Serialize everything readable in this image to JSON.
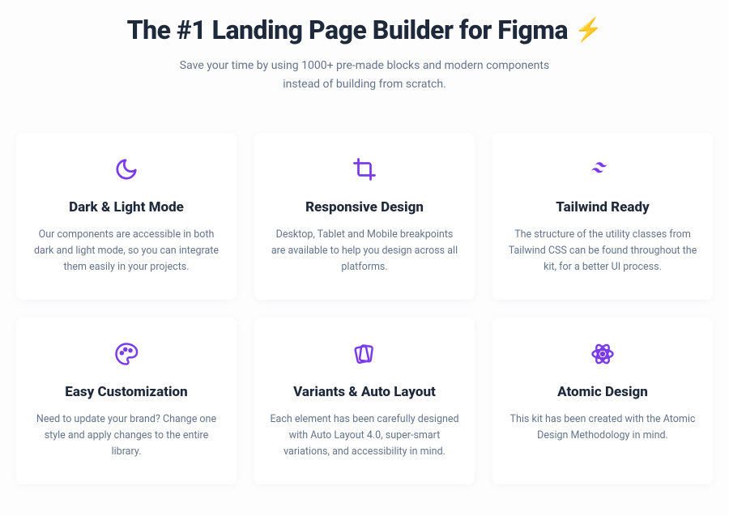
{
  "hero": {
    "title": "The #1 Landing Page Builder for Figma",
    "subtitle": "Save your time by using 1000+ pre-made blocks and modern components instead of building from scratch."
  },
  "features": [
    {
      "icon": "moon-icon",
      "title": "Dark & Light Mode",
      "desc": "Our components are accessible in both dark and light mode, so you can integrate them easily in your projects."
    },
    {
      "icon": "crop-icon",
      "title": "Responsive Design",
      "desc": "Desktop, Tablet and Mobile breakpoints are available to help you design across all platforms."
    },
    {
      "icon": "tailwind-icon",
      "title": "Tailwind Ready",
      "desc": "The structure of the utility classes from Tailwind CSS can be found throughout the kit, for a better UI process."
    },
    {
      "icon": "palette-icon",
      "title": "Easy Customization",
      "desc": "Need to update your brand? Change one style and apply changes to the entire library."
    },
    {
      "icon": "cards-icon",
      "title": "Variants & Auto Layout",
      "desc": "Each element has been carefully designed with Auto Layout 4.0, super-smart variations, and accessibility in mind."
    },
    {
      "icon": "atom-icon",
      "title": "Atomic Design",
      "desc": "This kit has been created with the Atomic Design Methodology in mind."
    }
  ],
  "colors": {
    "accent": "#7c3aed"
  }
}
